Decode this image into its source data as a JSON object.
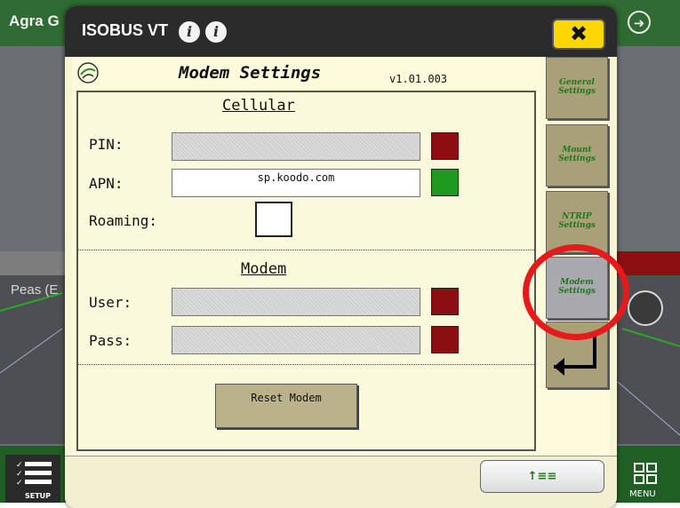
{
  "background_app": {
    "title": "Agra G",
    "field_label": "Peas (E",
    "setup_label": "SETUP",
    "menu_label": "MENU",
    "icons": [
      "arrow-right-circle-icon",
      "setup-list-icon",
      "menu-grid-icon",
      "route-split-icon"
    ]
  },
  "dialog": {
    "title": "ISOBUS VT",
    "close_icon": "close-x-icon",
    "screen_title": "Modem Settings",
    "version": "v1.01.003",
    "cellular": {
      "heading": "Cellular",
      "pin_label": "PIN:",
      "pin_value": "",
      "pin_status_color": "#8b0e10",
      "apn_label": "APN:",
      "apn_value": "sp.koodo.com",
      "apn_status_color": "#1f9a1f",
      "roaming_label": "Roaming:",
      "roaming_checked": false
    },
    "modem": {
      "heading": "Modem",
      "user_label": "User:",
      "user_value": "",
      "user_status_color": "#8b0e10",
      "pass_label": "Pass:",
      "pass_value": "",
      "pass_status_color": "#8b0e10",
      "reset_label": "Reset Modem"
    },
    "side_buttons": [
      {
        "label_line1": "General",
        "label_line2": "Settings"
      },
      {
        "label_line1": "Mount",
        "label_line2": "Settings"
      },
      {
        "label_line1": "NTRIP",
        "label_line2": "Settings"
      },
      {
        "label_line1": "Modem",
        "label_line2": "Settings",
        "active": true
      }
    ],
    "back_icon": "return-arrow-icon",
    "footer_button": "↑≡≡"
  },
  "accent_colors": {
    "close_button": "#ffd600",
    "highlight_ring": "#e8191a",
    "side_label_green": "#1a7a1a"
  }
}
